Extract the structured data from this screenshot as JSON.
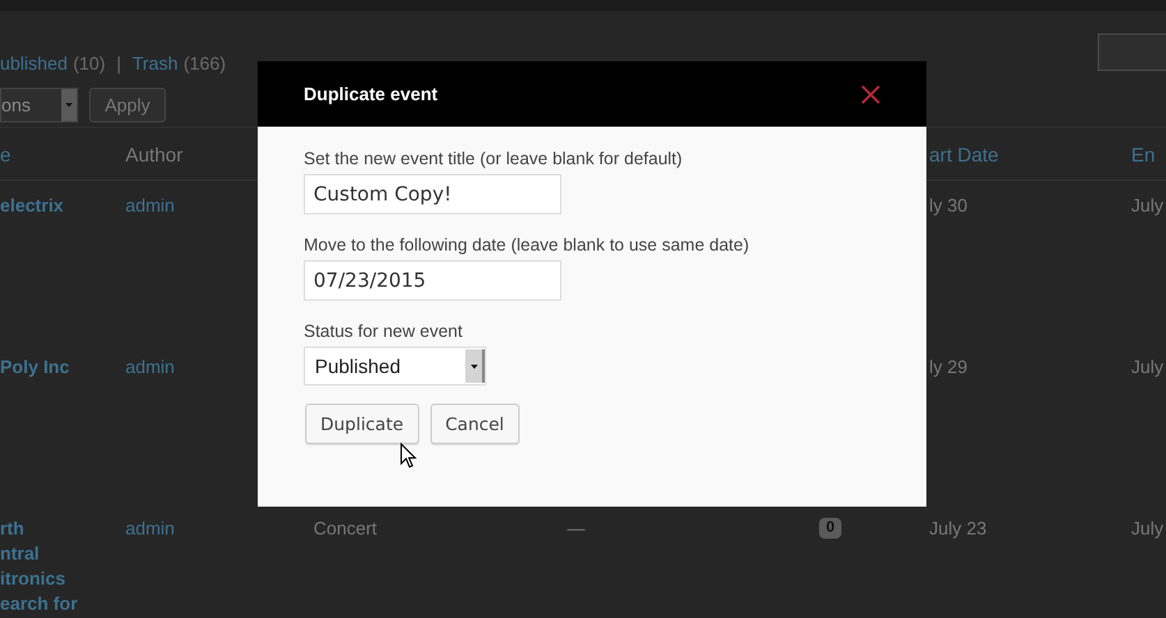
{
  "background": {
    "filters": [
      {
        "label": "ublished",
        "count": "(10)"
      },
      {
        "label": "Trash",
        "count": "(166)"
      }
    ],
    "separator": "|",
    "bulk_action": {
      "value": "ons"
    },
    "apply_button": "Apply",
    "table": {
      "columns": [
        "e",
        "Author",
        "",
        "",
        "",
        "art Date",
        "En"
      ],
      "rows": [
        {
          "title_lines": [
            "electrix"
          ],
          "author": "admin",
          "category": "",
          "dash": "",
          "comments": "",
          "start": "ly 30",
          "end": "July"
        },
        {
          "title_lines": [
            "Poly Inc"
          ],
          "author": "admin",
          "category": "",
          "dash": "",
          "comments": "",
          "start": "ly 29",
          "end": "July"
        },
        {
          "title_lines": [
            "rth",
            "ntral",
            "itronics",
            "earch for"
          ],
          "author": "admin",
          "category": "Concert",
          "dash": "—",
          "comments": "0",
          "start": "July 23",
          "end": "July"
        }
      ]
    }
  },
  "dialog": {
    "title": "Duplicate event",
    "fields": [
      {
        "kind": "text",
        "label": "Set the new event title (or leave blank for default)",
        "value": "Custom Copy!"
      },
      {
        "kind": "text",
        "label": "Move to the following date (leave blank to use same date)",
        "value": "07/23/2015"
      },
      {
        "kind": "select",
        "label": "Status for new event",
        "value": "Published"
      }
    ],
    "buttons": [
      "Duplicate",
      "Cancel"
    ]
  }
}
